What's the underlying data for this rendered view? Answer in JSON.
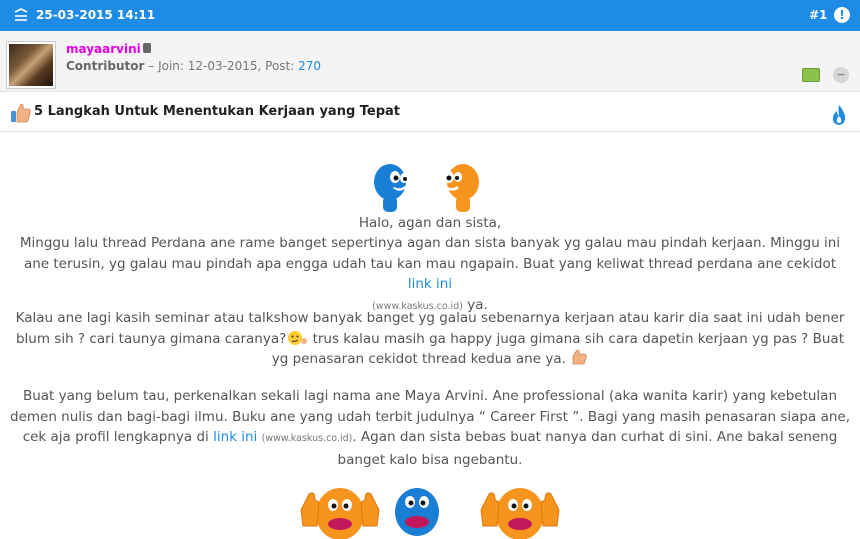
{
  "header": {
    "date": "25-03-2015 14:11",
    "post_number": "#1",
    "alert_symbol": "!"
  },
  "user": {
    "name": "mayaarvini",
    "role": "Contributor",
    "join": "12-03-2015",
    "post_count": "270",
    "join_label": "Join:",
    "post_label": "Post:",
    "frown_symbol": "−"
  },
  "thread": {
    "title": "5 Langkah Untuk Menentukan Kerjaan yang Tepat"
  },
  "body": {
    "greeting": "Halo, agan dan sista,",
    "p1_a": "Minggu lalu thread Perdana ane rame banget sepertinya agan dan sista banyak yg galau mau pindah kerjaan. Minggu ini ane terusin, yg galau mau pindah apa engga udah tau kan mau ngapain. Buat yang keliwat thread perdana ane cekidot ",
    "p1_link": "link ini",
    "p1_src": "(www.kaskus.co.id)",
    "p1_b": " ya.",
    "p2_a": "Kalau ane lagi kasih seminar atau talkshow banyak banget yg galau sebenarnya kerjaan atau karir dia saat ini udah bener blum sih ? cari taunya gimana caranya?",
    "p2_b": " trus kalau masih ga happy juga gimana sih cara dapetin kerjaan yg pas ? Buat yg penasaran cekidot thread kedua ane ya. ",
    "p3_a": "Buat yang belum tau, perkenalkan sekali lagi nama ane Maya Arvini. Ane professional (aka wanita karir) yang kebetulan demen nulis dan bagi-bagi ilmu. Buku ane yang udah terbit judulnya “ Career First ”. Bagi yang masih penasaran siapa ane, cek aja profil lengkapnya di ",
    "p3_link": "link ini",
    "p3_src": "(www.kaskus.co.id)",
    "p3_b": ". Agan dan sista bebas buat nanya dan curhat di sini. Ane bakal seneng banget kalo bisa ngebantu."
  },
  "colors": {
    "header_blue": "#1e8ce6",
    "username_magenta": "#e600e6",
    "link_blue": "#1e8ce6",
    "emoticon_blue": "#1a7fd4",
    "emoticon_orange": "#f7941d"
  },
  "icons": [
    "header-lines-icon",
    "alert-icon",
    "status-phone-icon",
    "car-icon",
    "frown-icon",
    "thumbs-up-icon",
    "flame-icon"
  ]
}
